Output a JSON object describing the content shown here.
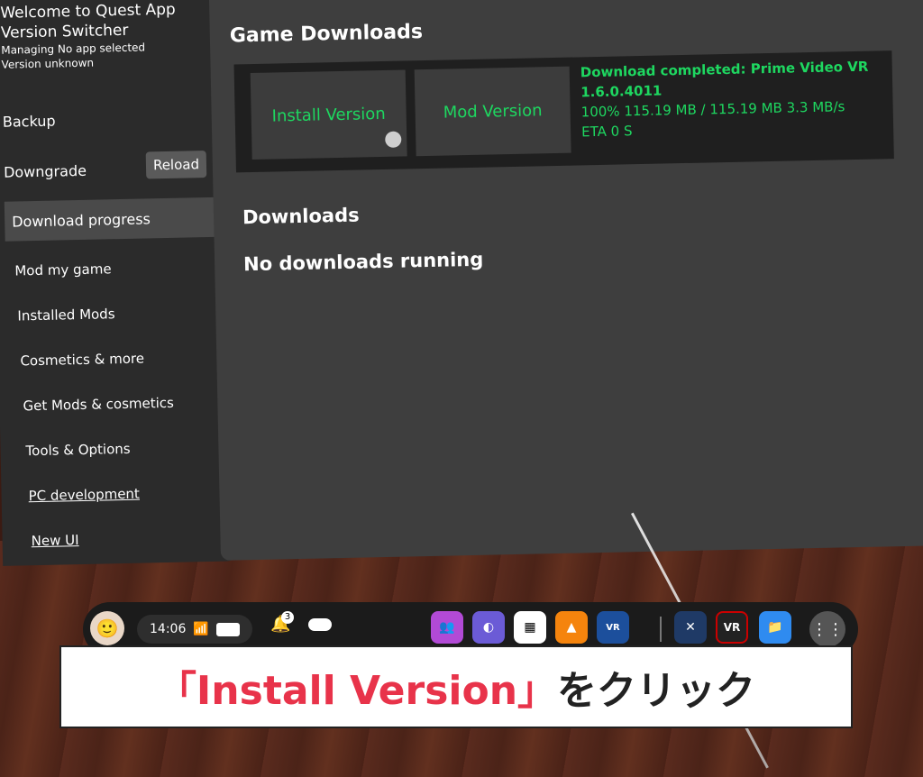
{
  "sidebar": {
    "title": "Welcome to Quest App",
    "subtitle": "Version Switcher",
    "managing": "Managing No app selected",
    "version": "Version unknown",
    "backup": "Backup",
    "downgrade": "Downgrade",
    "reload": "Reload",
    "nav": {
      "download_progress": "Download progress",
      "mod_my_game": "Mod my game",
      "installed_mods": "Installed Mods",
      "cosmetics": "Cosmetics & more",
      "get_mods": "Get Mods & cosmetics",
      "tools": "Tools & Options",
      "pc_dev": "PC development",
      "new_ui": "New UI"
    }
  },
  "main": {
    "title": "Game Downloads",
    "install_button": "Install Version",
    "mod_button": "Mod Version",
    "status_line1": "Download completed: Prime Video VR",
    "status_line2": "1.6.0.4011",
    "status_line3": "100% 115.19 MB / 115.19 MB 3.3 MB/s",
    "status_line4": "ETA 0 S",
    "downloads_heading": "Downloads",
    "no_downloads": "No downloads running"
  },
  "taskbar": {
    "time": "14:06",
    "notification_count": "3",
    "apps": [
      {
        "icon": "people-icon",
        "color": "#b24ad6"
      },
      {
        "icon": "explore-icon",
        "color": "#6b5bd6"
      },
      {
        "icon": "puzzle-icon",
        "color": "#ffffff"
      },
      {
        "icon": "vlc-icon",
        "color": "#f5840d"
      },
      {
        "icon": "vr-video-icon",
        "color": "#1c4f9c"
      },
      {
        "icon": "x-app-icon",
        "color": "#1f3a66"
      },
      {
        "icon": "mobile-vr-station-icon",
        "color": "#222222"
      },
      {
        "icon": "files-icon",
        "color": "#2f8bf0"
      }
    ]
  },
  "caption": {
    "highlight": "「Install Version」",
    "rest": "をクリック"
  }
}
